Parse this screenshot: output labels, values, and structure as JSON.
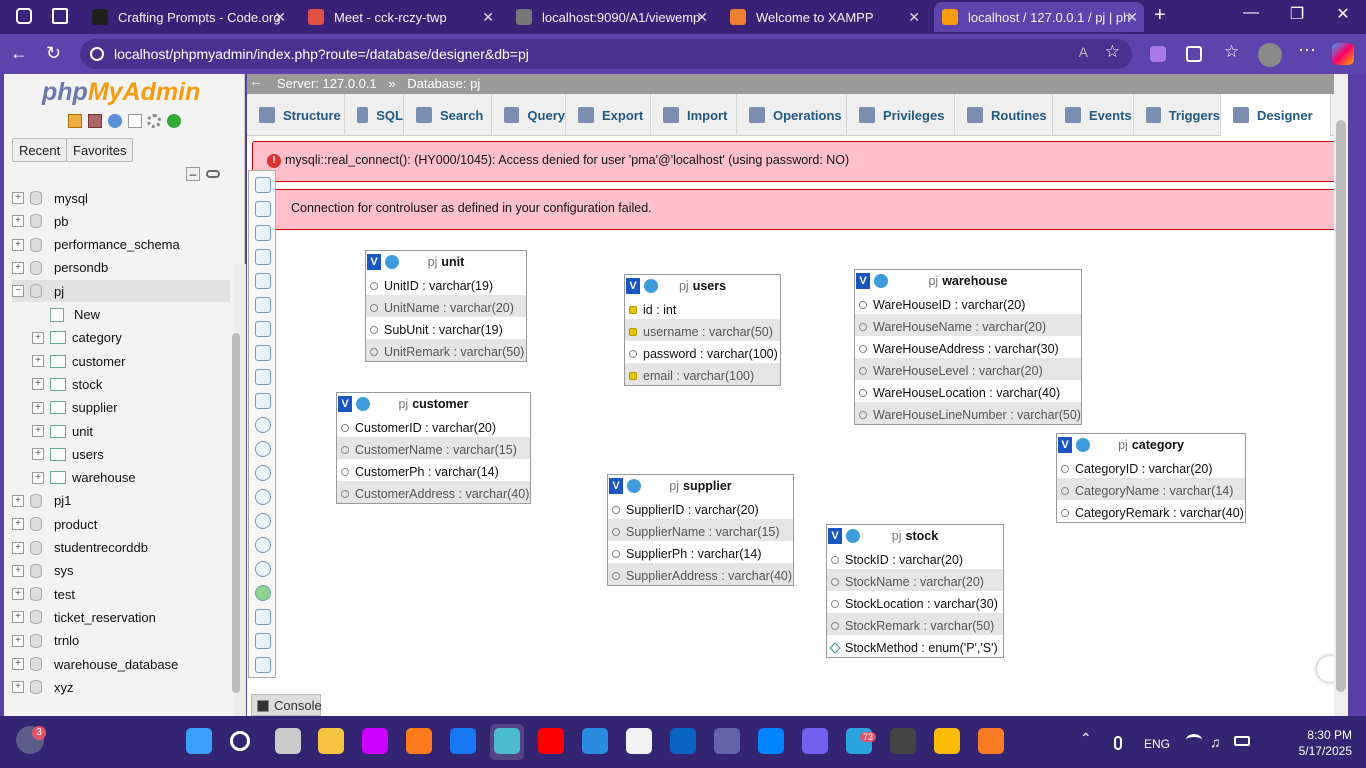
{
  "browser": {
    "tabs": [
      {
        "label": "Crafting Prompts - Code.org",
        "color": "#1f1f1f"
      },
      {
        "label": "Meet - cck-rczy-twp",
        "color": "#e25243"
      },
      {
        "label": "localhost:9090/A1/viewemp",
        "color": "#777777"
      },
      {
        "label": "Welcome to XAMPP",
        "color": "#f17f33"
      },
      {
        "label": "localhost / 127.0.0.1 / pj | ph",
        "color": "#f89c0e"
      }
    ],
    "new_tab_symbol": "+",
    "url": "localhost/phpmyadmin/index.php?route=/database/designer&db=pj"
  },
  "left_panel": {
    "logo_php": "php",
    "logo_admin": "MyAdmin",
    "buttons": {
      "recent": "Recent",
      "favorites": "Favorites"
    },
    "databases": [
      {
        "name": "mysql",
        "expander": "+"
      },
      {
        "name": "pb",
        "expander": "+"
      },
      {
        "name": "performance_schema",
        "expander": "+"
      },
      {
        "name": "persondb",
        "expander": "+"
      },
      {
        "name": "pj",
        "expander": "−"
      },
      {
        "name": "New",
        "child": true,
        "type": "new"
      },
      {
        "name": "category",
        "child": true,
        "type": "table"
      },
      {
        "name": "customer",
        "child": true,
        "type": "table"
      },
      {
        "name": "stock",
        "child": true,
        "type": "table"
      },
      {
        "name": "supplier",
        "child": true,
        "type": "table"
      },
      {
        "name": "unit",
        "child": true,
        "type": "table"
      },
      {
        "name": "users",
        "child": true,
        "type": "table"
      },
      {
        "name": "warehouse",
        "child": true,
        "type": "table"
      },
      {
        "name": "pj1",
        "expander": "+"
      },
      {
        "name": "product",
        "expander": "+"
      },
      {
        "name": "studentrecorddb",
        "expander": "+"
      },
      {
        "name": "sys",
        "expander": "+"
      },
      {
        "name": "test",
        "expander": "+"
      },
      {
        "name": "ticket_reservation",
        "expander": "+"
      },
      {
        "name": "trnlo",
        "expander": "+"
      },
      {
        "name": "warehouse_database",
        "expander": "+"
      },
      {
        "name": "xyz",
        "expander": "+"
      }
    ]
  },
  "breadcrumb": {
    "server": "Server: 127.0.0.1",
    "separator": "»",
    "database": "Database: pj"
  },
  "tabs": [
    {
      "label": "Structure"
    },
    {
      "label": "SQL"
    },
    {
      "label": "Search"
    },
    {
      "label": "Query"
    },
    {
      "label": "Export"
    },
    {
      "label": "Import"
    },
    {
      "label": "Operations"
    },
    {
      "label": "Privileges"
    },
    {
      "label": "Routines"
    },
    {
      "label": "Events"
    },
    {
      "label": "Triggers"
    },
    {
      "label": "Designer",
      "active": true
    }
  ],
  "errors": [
    "mysqli::real_connect(): (HY000/1045): Access denied for user 'pma'@'localhost' (using password: NO)",
    "Connection for controluser as defined in your configuration failed."
  ],
  "designer_tables": [
    {
      "db": "pj",
      "name": "unit",
      "columns": [
        {
          "text": "UnitID : varchar(19)",
          "key": false
        },
        {
          "text": "UnitName : varchar(20)",
          "key": false
        },
        {
          "text": "SubUnit : varchar(19)",
          "key": false
        },
        {
          "text": "UnitRemark : varchar(50)",
          "key": false
        }
      ]
    },
    {
      "db": "pj",
      "name": "users",
      "columns": [
        {
          "text": "id : int",
          "key": true
        },
        {
          "text": "username : varchar(50)",
          "key": true
        },
        {
          "text": "password : varchar(100)",
          "key": false
        },
        {
          "text": "email : varchar(100)",
          "key": true
        }
      ]
    },
    {
      "db": "pj",
      "name": "warehouse",
      "columns": [
        {
          "text": "WareHouseID : varchar(20)",
          "key": false
        },
        {
          "text": "WareHouseName : varchar(20)",
          "key": false
        },
        {
          "text": "WareHouseAddress : varchar(30)",
          "key": false
        },
        {
          "text": "WareHouseLevel : varchar(20)",
          "key": false
        },
        {
          "text": "WareHouseLocation : varchar(40)",
          "key": false
        },
        {
          "text": "WareHouseLineNumber : varchar(50)",
          "key": false
        }
      ]
    },
    {
      "db": "pj",
      "name": "customer",
      "columns": [
        {
          "text": "CustomerID : varchar(20)",
          "key": false
        },
        {
          "text": "CustomerName : varchar(15)",
          "key": false
        },
        {
          "text": "CustomerPh : varchar(14)",
          "key": false
        },
        {
          "text": "CustomerAddress : varchar(40)",
          "key": false
        }
      ]
    },
    {
      "db": "pj",
      "name": "category",
      "columns": [
        {
          "text": "CategoryID : varchar(20)",
          "key": false
        },
        {
          "text": "CategoryName : varchar(14)",
          "key": false
        },
        {
          "text": "CategoryRemark : varchar(40)",
          "key": false
        }
      ]
    },
    {
      "db": "pj",
      "name": "supplier",
      "columns": [
        {
          "text": "SupplierID : varchar(20)",
          "key": false
        },
        {
          "text": "SupplierName : varchar(15)",
          "key": false
        },
        {
          "text": "SupplierPh : varchar(14)",
          "key": false
        },
        {
          "text": "SupplierAddress : varchar(40)",
          "key": false
        }
      ]
    },
    {
      "db": "pj",
      "name": "stock",
      "columns": [
        {
          "text": "StockID : varchar(20)",
          "key": false
        },
        {
          "text": "StockName : varchar(20)",
          "key": false
        },
        {
          "text": "StockLocation : varchar(30)",
          "key": false
        },
        {
          "text": "StockRemark : varchar(50)",
          "key": false
        },
        {
          "text": "StockMethod : enum('P','S')",
          "key": false,
          "enum": true
        }
      ]
    }
  ],
  "console_label": "Console",
  "taskbar": {
    "notification_badge": "3",
    "telegram_badge": "73",
    "language": "ENG",
    "time": "8:30 PM",
    "date": "5/17/2025"
  }
}
